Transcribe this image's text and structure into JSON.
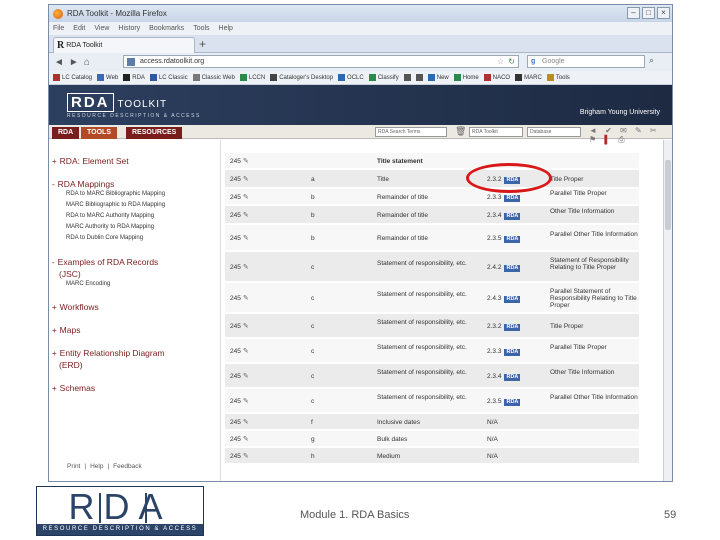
{
  "browser": {
    "title": "RDA Toolkit - Mozilla Firefox",
    "menu": [
      "File",
      "Edit",
      "View",
      "History",
      "Bookmarks",
      "Tools",
      "Help"
    ],
    "tab_label": "RDA Toolkit",
    "url": "access.rdatoolkit.org",
    "search_placeholder": "Google",
    "bookmarks": [
      "LC Catalog",
      "Web",
      "RDA",
      "LC Classic",
      "Classic Web",
      "LCCN",
      "Cataloger's Desktop",
      "OCLC",
      "Classify",
      "",
      "",
      "New",
      "Home",
      "NACO",
      "MARC",
      "Tools",
      ""
    ]
  },
  "rda": {
    "logo_main": "RDA",
    "logo_word": "TOOLKIT",
    "logo_sub": "RESOURCE DESCRIPTION & ACCESS",
    "user": "Brigham Young University",
    "nav": [
      "RDA",
      "TOOLS",
      "RESOURCES"
    ],
    "search_placeholder": "RDA Search Terms",
    "field_one": "RDA Toolkit",
    "field_two": "Database"
  },
  "sidebar": {
    "sections": [
      {
        "bullet": "+",
        "label": "RDA: Element Set"
      },
      {
        "bullet": "-",
        "label": "RDA Mappings"
      },
      {
        "bullet": "-",
        "label": "Examples of RDA Records"
      },
      {
        "bullet": "",
        "label": "(JSC)"
      },
      {
        "bullet": "+",
        "label": "Workflows"
      },
      {
        "bullet": "+",
        "label": "Maps"
      },
      {
        "bullet": "+",
        "label": "Entity Relationship Diagram"
      },
      {
        "bullet": "",
        "label": "(ERD)"
      },
      {
        "bullet": "+",
        "label": "Schemas"
      }
    ],
    "mappings": [
      "RDA to MARC Bibliographic Mapping",
      "MARC Bibliographic to RDA Mapping",
      "RDA to MARC Authority Mapping",
      "MARC Authority to RDA Mapping",
      "RDA to Dublin Core Mapping"
    ],
    "examples": [
      "MARC Encoding"
    ],
    "footer": [
      "Print",
      "|",
      "Help",
      "|",
      "Feedback"
    ]
  },
  "table": {
    "rows": [
      {
        "tag": "245",
        "code": "",
        "label": "Title statement",
        "rule": "",
        "element": ""
      },
      {
        "tag": "245",
        "code": "a",
        "label": "Title",
        "rule": "2.3.2",
        "element": "Title Proper"
      },
      {
        "tag": "245",
        "code": "b",
        "label": "Remainder of title",
        "rule": "2.3.3",
        "element": "Parallel Title Proper"
      },
      {
        "tag": "245",
        "code": "b",
        "label": "Remainder of title",
        "rule": "2.3.4",
        "element": "Other Title Information"
      },
      {
        "tag": "245",
        "code": "b",
        "label": "Remainder of title",
        "rule": "2.3.5",
        "element": "Parallel Other Title Information"
      },
      {
        "tag": "245",
        "code": "c",
        "label": "Statement of responsibility, etc.",
        "rule": "2.4.2",
        "element": "Statement of Responsibility Relating to Title Proper"
      },
      {
        "tag": "245",
        "code": "c",
        "label": "Statement of responsibility, etc.",
        "rule": "2.4.3",
        "element": "Parallel Statement of Responsibility Relating to Title Proper"
      },
      {
        "tag": "245",
        "code": "c",
        "label": "Statement of responsibility, etc.",
        "rule": "2.3.2",
        "element": "Title Proper"
      },
      {
        "tag": "245",
        "code": "c",
        "label": "Statement of responsibility, etc.",
        "rule": "2.3.3",
        "element": "Parallel Title Proper"
      },
      {
        "tag": "245",
        "code": "c",
        "label": "Statement of responsibility, etc.",
        "rule": "2.3.4",
        "element": "Other Title Information"
      },
      {
        "tag": "245",
        "code": "c",
        "label": "Statement of responsibility, etc.",
        "rule": "2.3.5",
        "element": "Parallel Other Title Information"
      },
      {
        "tag": "245",
        "code": "f",
        "label": "Inclusive dates",
        "rule": "N/A",
        "element": ""
      },
      {
        "tag": "245",
        "code": "g",
        "label": "Bulk dates",
        "rule": "N/A",
        "element": ""
      },
      {
        "tag": "245",
        "code": "h",
        "label": "Medium",
        "rule": "N/A",
        "element": ""
      }
    ],
    "badge": "RDA"
  },
  "slide": {
    "logo_letters": "RDA",
    "logo_band": "RESOURCE DESCRIPTION & ACCESS",
    "footer_text": "Module 1. RDA Basics",
    "page_number": "59"
  },
  "colors": {
    "rda_dark_red": "#7a1d1d",
    "tools_orange": "#b04a27",
    "header_navy": "#2d3f5f",
    "badge_blue": "#3c64a8",
    "annotation_red": "#d81818"
  }
}
